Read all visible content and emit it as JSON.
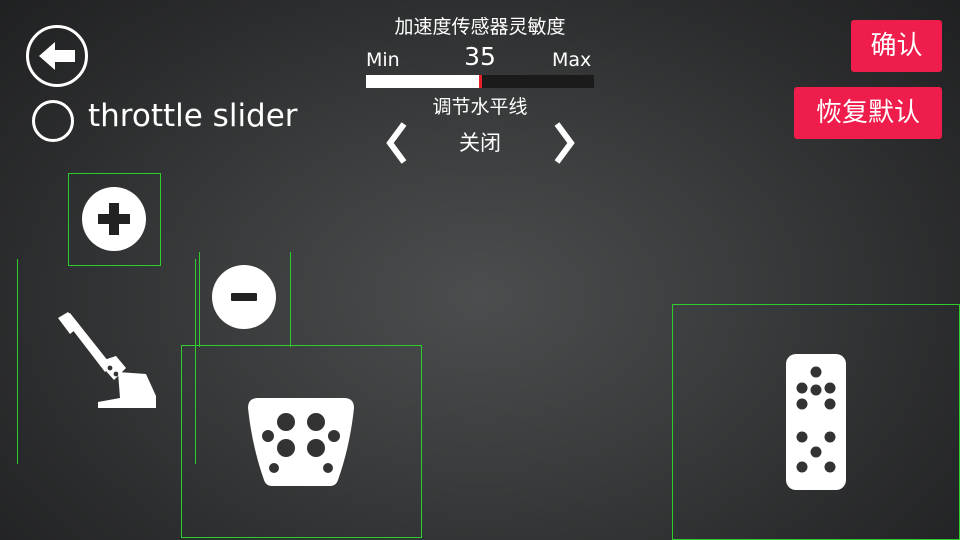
{
  "header": {
    "sensitivity_title": "加速度传感器灵敏度",
    "min_label": "Min",
    "max_label": "Max",
    "sensitivity_value": "35",
    "sensitivity_fraction": 0.5,
    "level_title": "调节水平线",
    "level_value": "关闭"
  },
  "controls": {
    "throttle_label": "throttle slider"
  },
  "buttons": {
    "confirm": "确认",
    "reset": "恢复默认"
  },
  "icons": {
    "back": "back-arrow-icon",
    "plus": "plus-icon",
    "minus": "minus-icon",
    "handbrake": "handbrake-lever-icon",
    "brake_pedal": "brake-pedal-icon",
    "gas_pedal": "gas-pedal-icon",
    "prev": "chevron-left-icon",
    "next": "chevron-right-icon"
  },
  "colors": {
    "accent_red": "#ee1d4b",
    "frame_green": "#2ecc2e",
    "slider_marker": "#e8202a"
  }
}
